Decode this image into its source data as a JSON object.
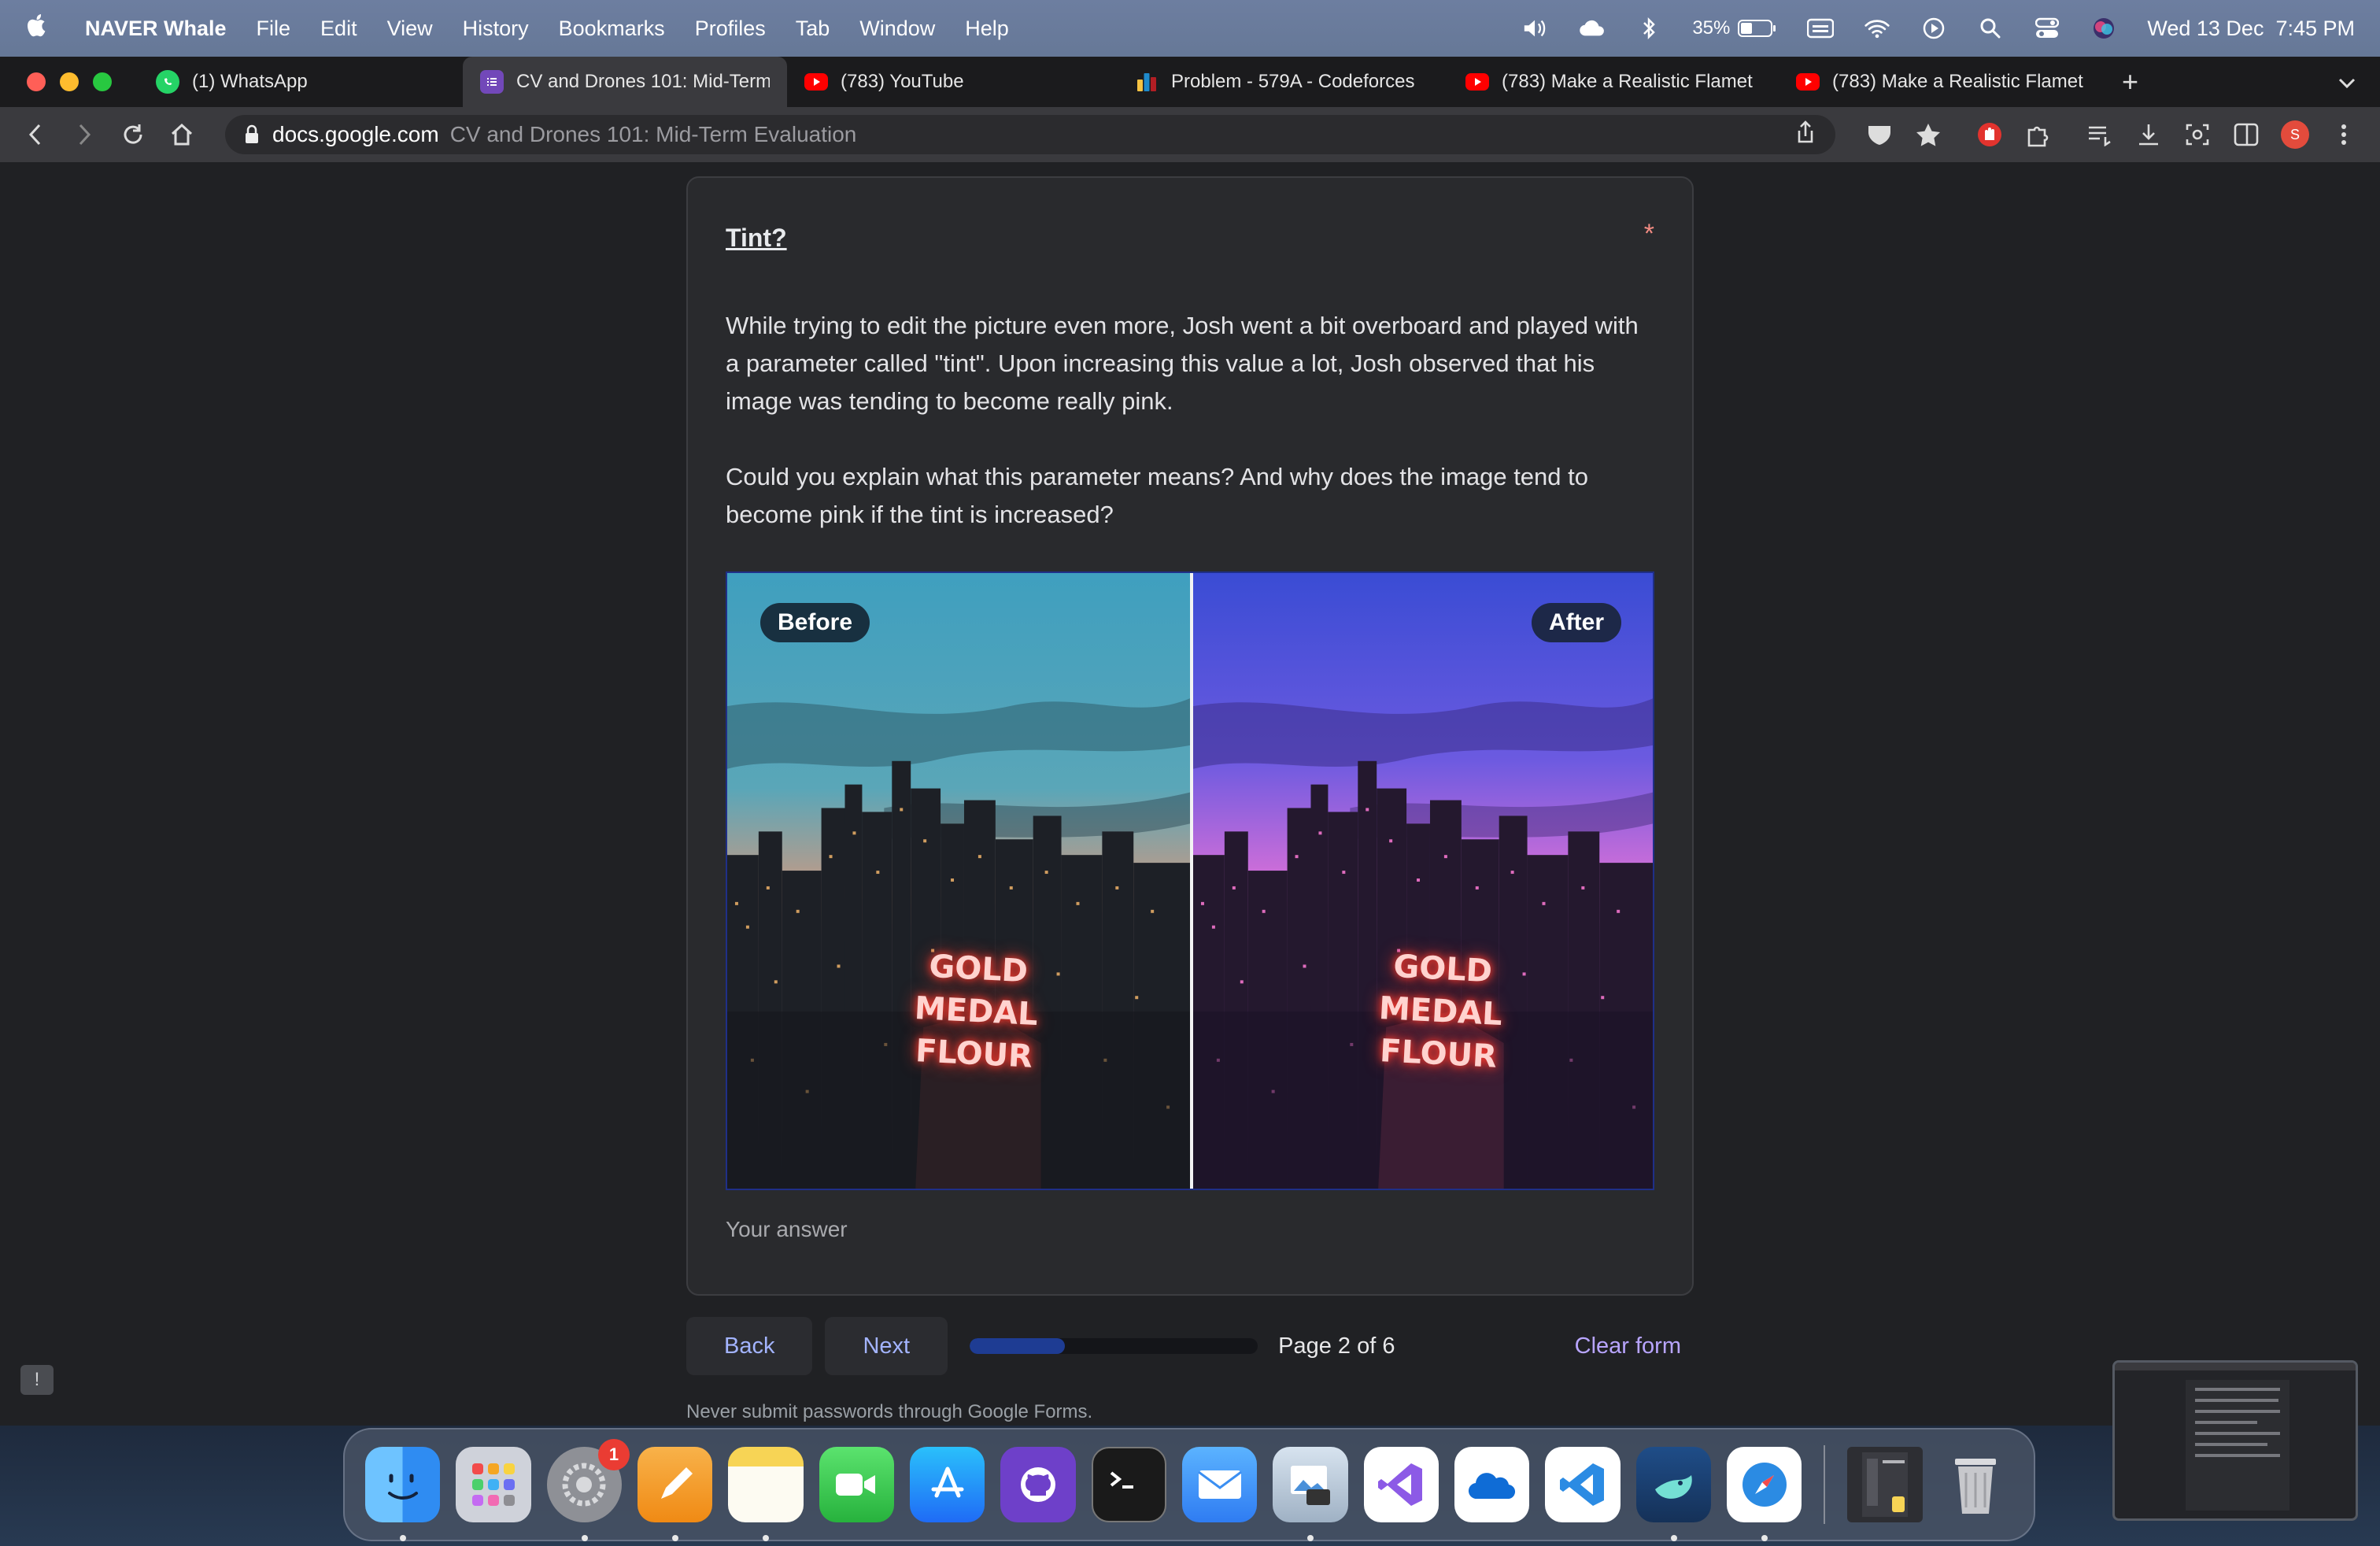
{
  "menubar": {
    "app_name": "NAVER Whale",
    "items": [
      "File",
      "Edit",
      "View",
      "History",
      "Bookmarks",
      "Profiles",
      "Tab",
      "Window",
      "Help"
    ],
    "battery": "35%",
    "datetime": "Wed 13 Dec  7:45 PM"
  },
  "tabs": [
    {
      "label": "(1) WhatsApp",
      "icon": "whatsapp-icon",
      "color": "#25d366"
    },
    {
      "label": "CV and Drones 101: Mid-Term",
      "icon": "google-forms-icon",
      "color": "#7248b9",
      "active": true
    },
    {
      "label": "(783) YouTube",
      "icon": "youtube-icon",
      "color": "#ff0000"
    },
    {
      "label": "Problem - 579A - Codeforces",
      "icon": "codeforces-icon",
      "color": "#1f8acb"
    },
    {
      "label": "(783) Make a Realistic Flamet",
      "icon": "youtube-icon",
      "color": "#ff0000"
    },
    {
      "label": "(783) Make a Realistic Flamet",
      "icon": "youtube-icon",
      "color": "#ff0000"
    }
  ],
  "address": {
    "domain": "docs.google.com",
    "path": "CV and Drones 101: Mid-Term Evaluation"
  },
  "question": {
    "title": "Tint?",
    "required_mark": "*",
    "paragraph_1": "While trying to edit the picture even more, Josh went a bit overboard and played with a parameter called \"tint\". Upon increasing this value a lot, Josh observed that his image was tending to become really pink.",
    "paragraph_2": "Could you explain what this parameter means? And why does the image tend to become pink if the tint is increased?",
    "image": {
      "before_label": "Before",
      "after_label": "After",
      "sign_lines": [
        "GOLD",
        "MEDAL",
        "FLOUR"
      ]
    },
    "answer_placeholder": "Your answer"
  },
  "footer": {
    "back_label": "Back",
    "next_label": "Next",
    "progress": 0.33,
    "page_label": "Page 2 of 6",
    "clear_label": "Clear form",
    "note": "Never submit passwords through Google Forms."
  },
  "dock": {
    "apps": [
      {
        "name": "finder",
        "color": "#2f8cf2",
        "running": true
      },
      {
        "name": "launchpad",
        "color": "#c9ccd4",
        "running": false
      },
      {
        "name": "system-settings",
        "color": "#8e9096",
        "running": true,
        "badge": "1"
      },
      {
        "name": "pages",
        "color": "#f29a20",
        "running": true
      },
      {
        "name": "notes",
        "color": "#f7d455",
        "running": true
      },
      {
        "name": "facetime",
        "color": "#39c04c",
        "running": false
      },
      {
        "name": "app-store",
        "color": "#1f8cf6",
        "running": false
      },
      {
        "name": "github-desktop",
        "color": "#6e40c9",
        "running": false
      },
      {
        "name": "terminal",
        "color": "#1a1a1a",
        "running": false
      },
      {
        "name": "mail",
        "color": "#3b8ff2",
        "running": false
      },
      {
        "name": "preview",
        "color": "#aab8c8",
        "running": true
      },
      {
        "name": "visual-studio",
        "color": "#8c5ae6",
        "running": false
      },
      {
        "name": "onedrive",
        "color": "#ffffff",
        "running": false
      },
      {
        "name": "vscode",
        "color": "#ffffff",
        "running": false
      },
      {
        "name": "whale",
        "color": "#1a3b66",
        "running": true
      },
      {
        "name": "safari",
        "color": "#ffffff",
        "running": true
      }
    ],
    "trash_label": "trash"
  }
}
